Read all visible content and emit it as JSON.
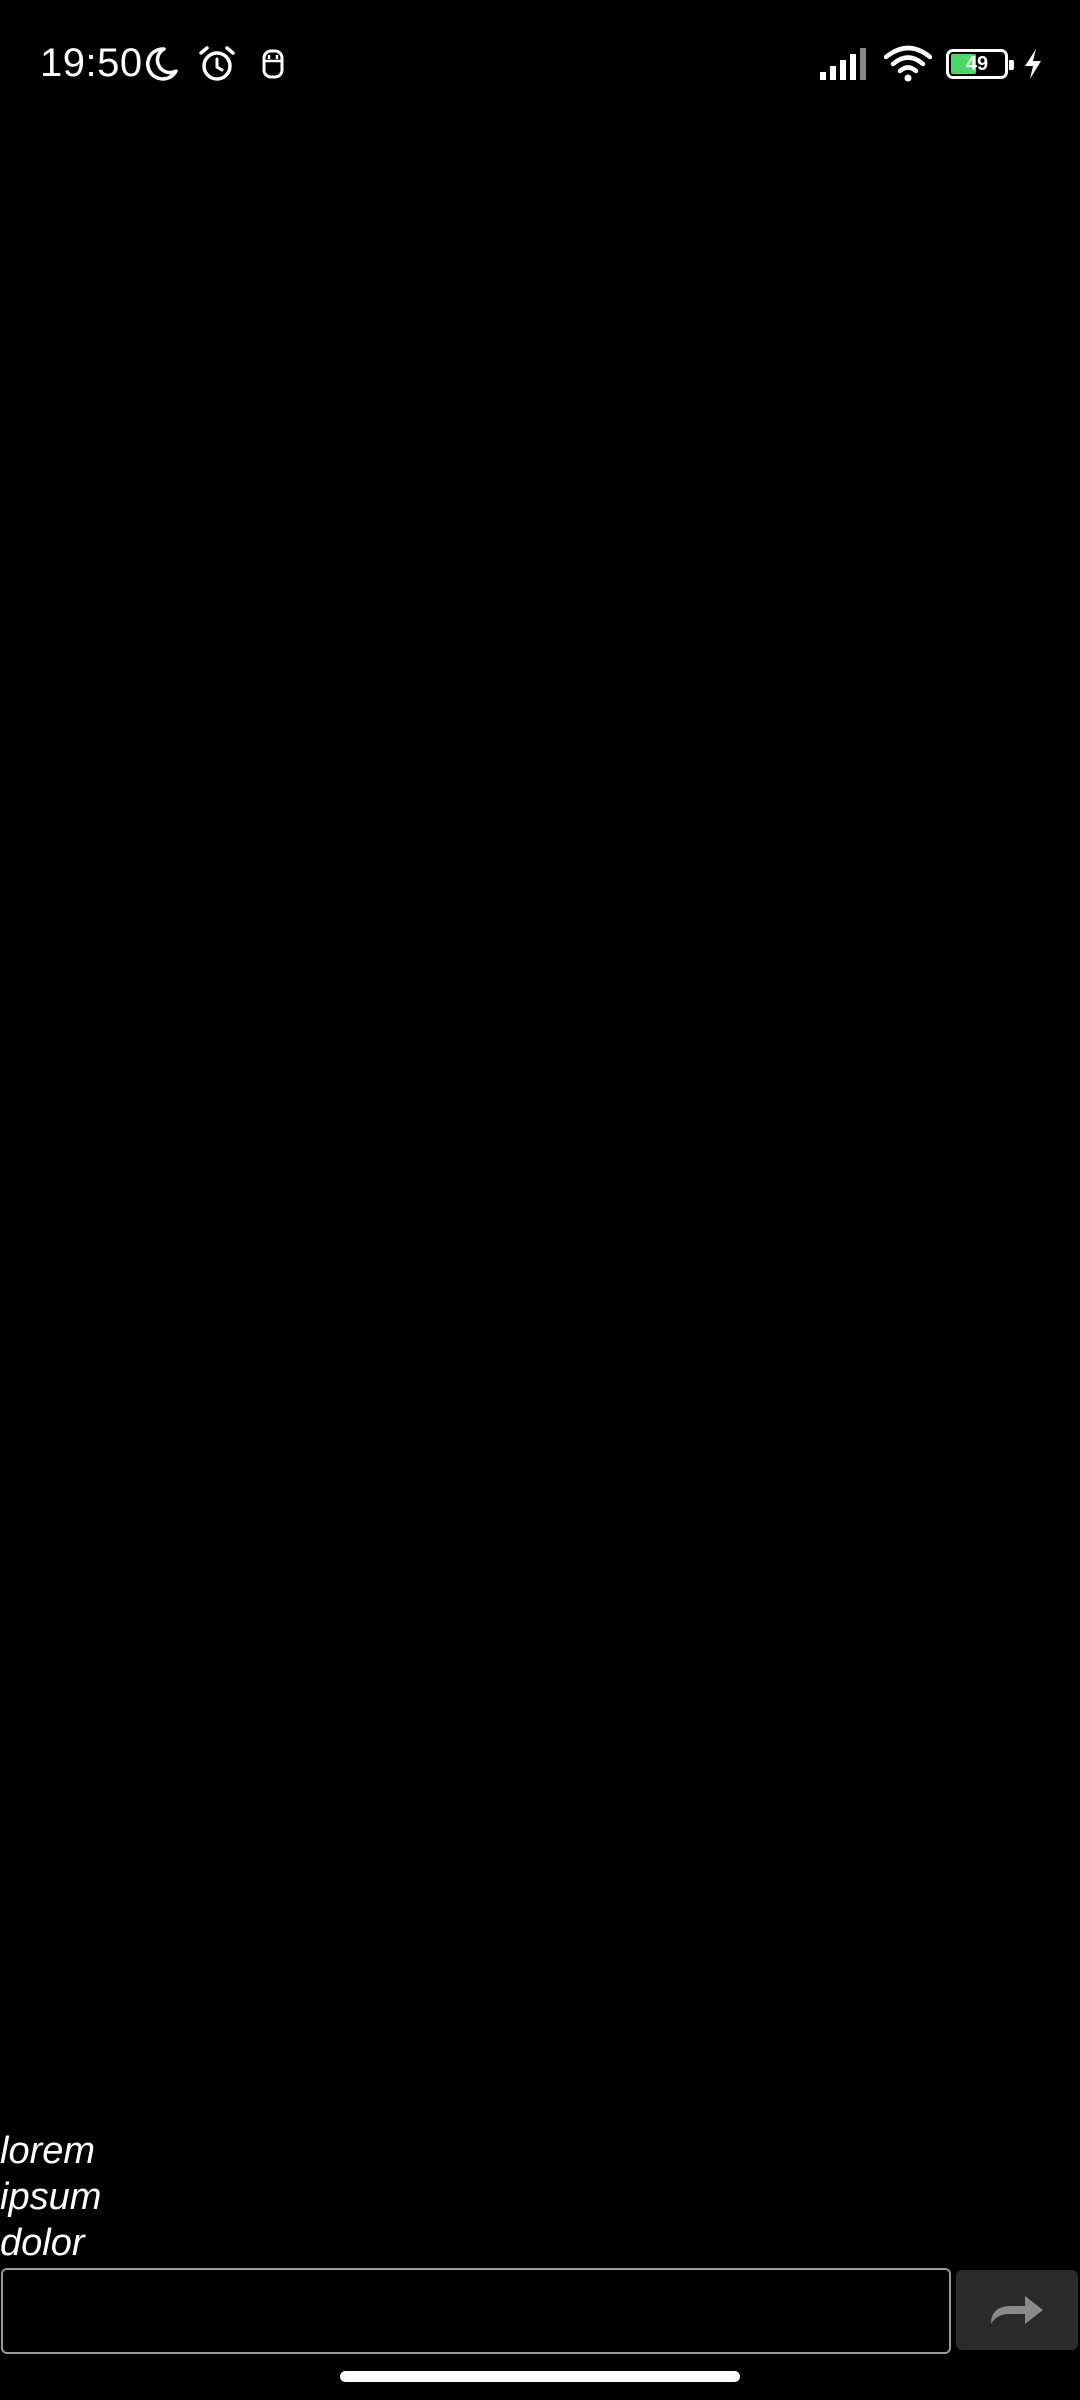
{
  "status_bar": {
    "time": "19:50",
    "left_icons": [
      "moon-icon",
      "alarm-clock-icon",
      "notification-icon"
    ],
    "right_icons": [
      "signal-icon",
      "wifi-icon",
      "battery-icon",
      "charging-icon"
    ],
    "battery_percent": "49",
    "battery_level": 0.49,
    "battery_color": "#4cd964"
  },
  "output": {
    "lines": [
      "lorem",
      "ipsum",
      "dolor"
    ]
  },
  "input": {
    "value": "",
    "placeholder": ""
  },
  "send_button": {
    "icon": "send-arrow-icon"
  },
  "colors": {
    "background": "#000000",
    "text": "#ffffff",
    "input_border": "#9a9a9a",
    "button_bg": "#2a2a2a",
    "button_icon": "#8a8a8a"
  }
}
